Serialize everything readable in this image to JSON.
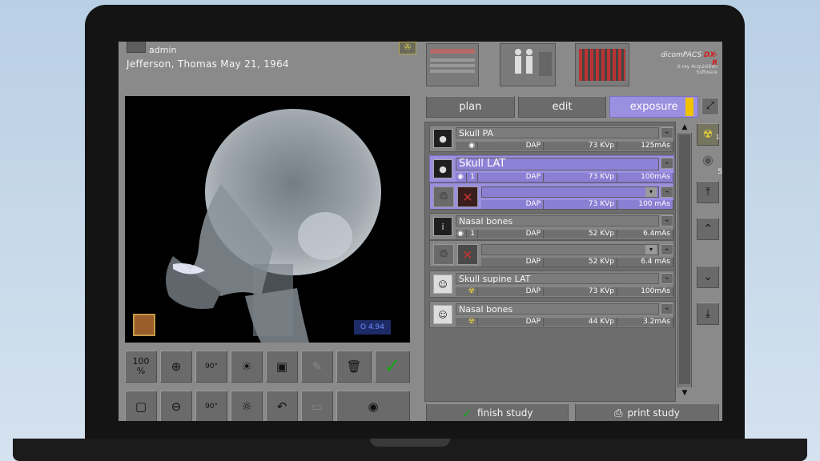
{
  "header": {
    "user_label": "admin",
    "patient": "Jefferson,  Thomas  May 21, 1964",
    "logo_brand": "dicomPACS",
    "logo_product": "DX-R",
    "logo_sub": "X-ray Acquisition Software"
  },
  "viewer": {
    "badge_right": "O  4.94"
  },
  "tools": {
    "zoom_100": "100\n%",
    "rotate_label": "90°"
  },
  "tabs": [
    {
      "label": "plan"
    },
    {
      "label": "edit"
    },
    {
      "label": "exposure"
    }
  ],
  "exams": [
    {
      "title": "Skull PA",
      "count": "",
      "dap": "DAP",
      "kvp": "73 KVp",
      "mas": "125mAs"
    },
    {
      "title": "Skull LAT",
      "count": "1",
      "dap": "DAP",
      "kvp": "73 KVp",
      "mas": "100mAs",
      "sub": {
        "dap": "DAP",
        "kvp": "73 KVp",
        "mas": "100 mAs"
      }
    },
    {
      "title": "Nasal bones",
      "count": "1",
      "dap": "DAP",
      "kvp": "52 KVp",
      "mas": "6.4mAs",
      "sub": {
        "dap": "DAP",
        "kvp": "52 KVp",
        "mas": "6.4 mAs"
      }
    },
    {
      "title": "Skull supine LAT",
      "count": "",
      "dap": "DAP",
      "kvp": "73 KVp",
      "mas": "100mAs"
    },
    {
      "title": "Nasal bones",
      "count": "",
      "dap": "DAP",
      "kvp": "44 KVp",
      "mas": "3.2mAs"
    }
  ],
  "side_panel": {
    "radiation_count": "1",
    "eye_count": "5"
  },
  "footer": {
    "finish": "finish study",
    "print": "print study"
  },
  "colors": {
    "accent": "#9b8fe0",
    "indicator": "#f0c200"
  }
}
